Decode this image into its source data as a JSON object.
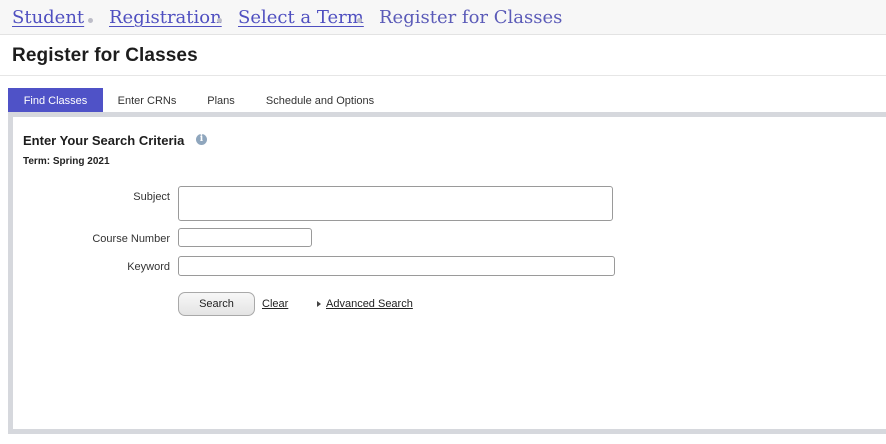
{
  "breadcrumb": {
    "items": [
      {
        "label": "Student",
        "link": true
      },
      {
        "label": "Registration",
        "link": true
      },
      {
        "label": "Select a Term",
        "link": true
      },
      {
        "label": "Register for Classes",
        "link": false
      }
    ]
  },
  "page": {
    "title": "Register for Classes"
  },
  "tabs": [
    {
      "label": "Find Classes",
      "active": true
    },
    {
      "label": "Enter CRNs",
      "active": false
    },
    {
      "label": "Plans",
      "active": false
    },
    {
      "label": "Schedule and Options",
      "active": false
    }
  ],
  "search": {
    "heading": "Enter Your Search Criteria",
    "info_icon": "info-icon",
    "term": "Term: Spring 2021",
    "fields": {
      "subject": {
        "label": "Subject",
        "value": ""
      },
      "course_number": {
        "label": "Course Number",
        "value": ""
      },
      "keyword": {
        "label": "Keyword",
        "value": ""
      }
    },
    "search_label": "Search",
    "clear_label": "Clear",
    "advanced_label": "Advanced Search"
  },
  "colors": {
    "accent": "#4f52c7",
    "link": "#4f4fc0",
    "frame": "#d6d8dd"
  }
}
